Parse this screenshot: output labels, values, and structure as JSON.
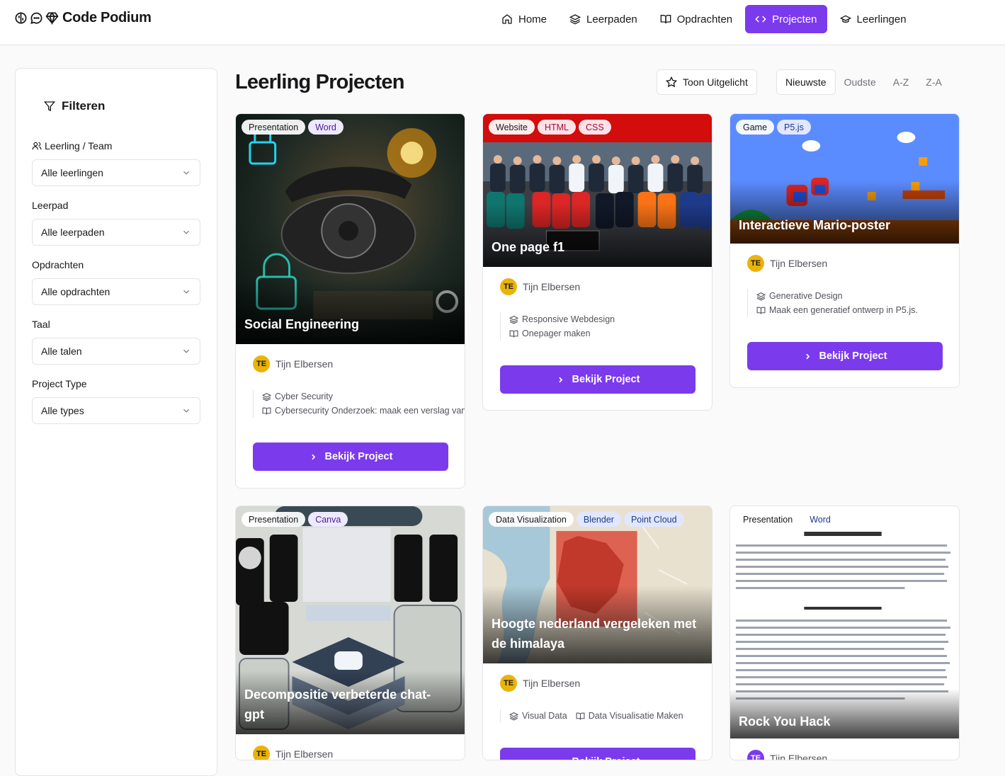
{
  "brand": {
    "name": "Code Podium"
  },
  "nav": [
    {
      "label": "Home",
      "icon": "home-icon"
    },
    {
      "label": "Leerpaden",
      "icon": "layers-icon"
    },
    {
      "label": "Opdrachten",
      "icon": "book-icon"
    },
    {
      "label": "Projecten",
      "icon": "code-icon",
      "active": true
    },
    {
      "label": "Leerlingen",
      "icon": "graduation-cap-icon"
    }
  ],
  "sidebar": {
    "title": "Filteren",
    "filters": [
      {
        "label": "Leerling / Team",
        "value": "Alle leerlingen"
      },
      {
        "label": "Leerpad",
        "value": "Alle leerpaden"
      },
      {
        "label": "Opdrachten",
        "value": "Alle opdrachten"
      },
      {
        "label": "Taal",
        "value": "Alle talen"
      },
      {
        "label": "Project Type",
        "value": "Alle types"
      }
    ]
  },
  "page": {
    "title": "Leerling Projecten",
    "featured_label": "Toon Uitgelicht"
  },
  "sort": {
    "options": [
      "Nieuwste",
      "Oudste",
      "A-Z",
      "Z-A"
    ],
    "active": "Nieuwste"
  },
  "button_label": "Bekijk Project",
  "colors": {
    "accent": "#7c3aed",
    "avatar": "#eab308"
  },
  "projects": [
    {
      "title": "Social Engineering",
      "tags": [
        "Presentation",
        "Word"
      ],
      "author": "Tijn Elbersen",
      "initials": "TE",
      "path": "Cyber Security",
      "assignment": "Cybersecurity Onderzoek: maak een verslag van"
    },
    {
      "title": "One page f1",
      "tags": [
        "Website",
        "HTML",
        "CSS"
      ],
      "author": "Tijn Elbersen",
      "initials": "TE",
      "path": "Responsive Webdesign",
      "assignment": "Onepager maken"
    },
    {
      "title": "Interactieve Mario-poster",
      "tags": [
        "Game",
        "P5.js"
      ],
      "author": "Tijn Elbersen",
      "initials": "TE",
      "path": "Generative Design",
      "assignment": "Maak een generatief ontwerp in P5.js."
    },
    {
      "title": "Decompositie verbeterde chat-gpt",
      "tags": [
        "Presentation",
        "Canva"
      ],
      "author": "Tijn Elbersen",
      "initials": "TE"
    },
    {
      "title": "Hoogte nederland vergeleken met de himalaya",
      "tags": [
        "Data Visualization",
        "Blender",
        "Point Cloud"
      ],
      "author": "Tijn Elbersen",
      "initials": "TE",
      "path": "Visual Data",
      "assignment": "Data Visualisatie Maken"
    },
    {
      "title": "Rock You Hack",
      "tags": [
        "Presentation",
        "Word"
      ],
      "author": "Tijn Elbersen",
      "initials": "TE"
    }
  ]
}
